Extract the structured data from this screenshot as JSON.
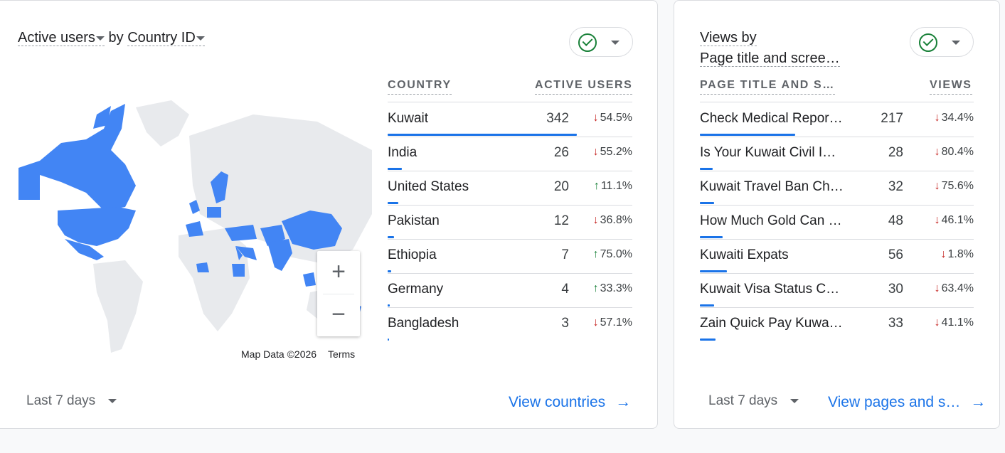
{
  "card1": {
    "title_metric": "Active users",
    "title_by": " by ",
    "title_dimension": "Country ID",
    "col_country": "COUNTRY",
    "col_users": "ACTIVE USERS",
    "rows": [
      {
        "name": "Kuwait",
        "value": "342",
        "change": "54.5%",
        "dir": "down",
        "bar_fraction": 1.0
      },
      {
        "name": "India",
        "value": "26",
        "change": "55.2%",
        "dir": "down",
        "bar_fraction": 0.076
      },
      {
        "name": "United States",
        "value": "20",
        "change": "11.1%",
        "dir": "up",
        "bar_fraction": 0.058
      },
      {
        "name": "Pakistan",
        "value": "12",
        "change": "36.8%",
        "dir": "down",
        "bar_fraction": 0.035
      },
      {
        "name": "Ethiopia",
        "value": "7",
        "change": "75.0%",
        "dir": "up",
        "bar_fraction": 0.02
      },
      {
        "name": "Germany",
        "value": "4",
        "change": "33.3%",
        "dir": "up",
        "bar_fraction": 0.012
      },
      {
        "name": "Bangladesh",
        "value": "3",
        "change": "57.1%",
        "dir": "down",
        "bar_fraction": 0.009
      }
    ],
    "map_attribution": "Map Data ©2026",
    "map_terms": "Terms",
    "zoom_in": "+",
    "zoom_out": "−",
    "date_range": "Last 7 days",
    "link": "View countries",
    "link_arrow": "→"
  },
  "card2": {
    "title_line1": "Views by",
    "title_line2": "Page title and scree…",
    "col_page": "PAGE TITLE AND S…",
    "col_views": "VIEWS",
    "rows": [
      {
        "name": "Check Medical Repor…",
        "value": "217",
        "change": "34.4%",
        "dir": "down",
        "bar_fraction": 0.67
      },
      {
        "name": "Is Your Kuwait Civil I…",
        "value": "28",
        "change": "80.4%",
        "dir": "down",
        "bar_fraction": 0.09
      },
      {
        "name": "Kuwait Travel Ban Ch…",
        "value": "32",
        "change": "75.6%",
        "dir": "down",
        "bar_fraction": 0.1
      },
      {
        "name": "How Much Gold Can …",
        "value": "48",
        "change": "46.1%",
        "dir": "down",
        "bar_fraction": 0.16
      },
      {
        "name": "Kuwaiti Expats",
        "value": "56",
        "change": "1.8%",
        "dir": "down",
        "bar_fraction": 0.19
      },
      {
        "name": "Kuwait Visa Status C…",
        "value": "30",
        "change": "63.4%",
        "dir": "down",
        "bar_fraction": 0.1
      },
      {
        "name": "Zain Quick Pay Kuwa…",
        "value": "33",
        "change": "41.1%",
        "dir": "down",
        "bar_fraction": 0.11
      }
    ],
    "date_range": "Last 7 days",
    "link": "View pages and s…",
    "link_arrow": "→"
  },
  "colors": {
    "accent": "#1a73e8",
    "down": "#c5221f",
    "up": "#188038",
    "map_active": "#4285f4",
    "map_inactive": "#e8eaed"
  },
  "icons": {
    "status": "check-circle-icon",
    "dropdown": "chevron-down-icon",
    "arrow_up": "↑",
    "arrow_down": "↓"
  }
}
